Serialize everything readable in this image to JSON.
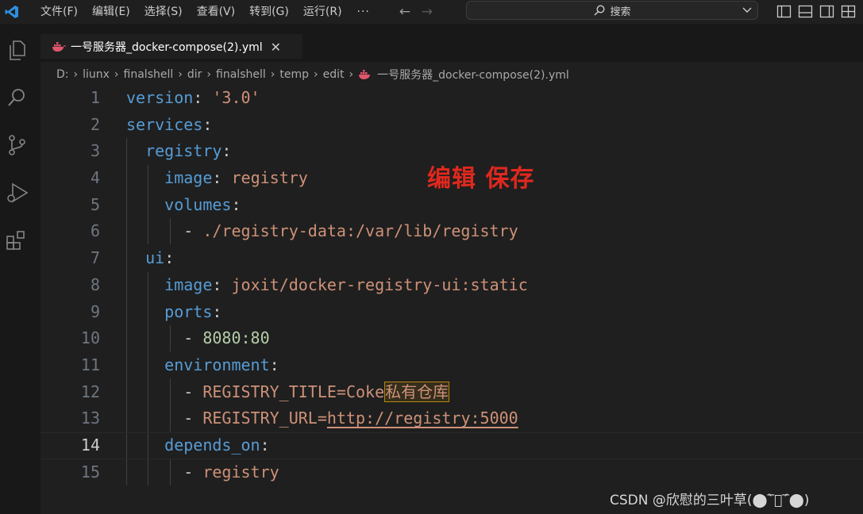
{
  "menu": {
    "items": [
      "文件(F)",
      "编辑(E)",
      "选择(S)",
      "查看(V)",
      "转到(G)",
      "运行(R)"
    ],
    "more": "···"
  },
  "search": {
    "label": "搜索"
  },
  "tab": {
    "title": "一号服务器_docker-compose(2).yml",
    "close": "✕"
  },
  "breadcrumb": [
    "D:",
    "liunx",
    "finalshell",
    "dir",
    "finalshell",
    "temp",
    "edit",
    "一号服务器_docker-compose(2).yml"
  ],
  "editor": {
    "current_line": 14,
    "lines": [
      {
        "no": "1",
        "tokens": [
          {
            "c": "k",
            "t": "version"
          },
          {
            "c": "p",
            "t": ": "
          },
          {
            "c": "s",
            "t": "'3.0'"
          }
        ]
      },
      {
        "no": "2",
        "tokens": [
          {
            "c": "k",
            "t": "services"
          },
          {
            "c": "p",
            "t": ":"
          }
        ]
      },
      {
        "no": "3",
        "tokens": [
          {
            "c": "p",
            "t": "  "
          },
          {
            "c": "k",
            "t": "registry"
          },
          {
            "c": "p",
            "t": ":"
          }
        ]
      },
      {
        "no": "4",
        "tokens": [
          {
            "c": "p",
            "t": "    "
          },
          {
            "c": "k",
            "t": "image"
          },
          {
            "c": "p",
            "t": ": "
          },
          {
            "c": "s",
            "t": "registry"
          }
        ]
      },
      {
        "no": "5",
        "tokens": [
          {
            "c": "p",
            "t": "    "
          },
          {
            "c": "k",
            "t": "volumes"
          },
          {
            "c": "p",
            "t": ":"
          }
        ]
      },
      {
        "no": "6",
        "tokens": [
          {
            "c": "p",
            "t": "      - "
          },
          {
            "c": "s",
            "t": "./registry-data:/var/lib/registry"
          }
        ]
      },
      {
        "no": "7",
        "tokens": [
          {
            "c": "p",
            "t": "  "
          },
          {
            "c": "k",
            "t": "ui"
          },
          {
            "c": "p",
            "t": ":"
          }
        ]
      },
      {
        "no": "8",
        "tokens": [
          {
            "c": "p",
            "t": "    "
          },
          {
            "c": "k",
            "t": "image"
          },
          {
            "c": "p",
            "t": ": "
          },
          {
            "c": "s",
            "t": "joxit/docker-registry-ui:static"
          }
        ]
      },
      {
        "no": "9",
        "tokens": [
          {
            "c": "p",
            "t": "    "
          },
          {
            "c": "k",
            "t": "ports"
          },
          {
            "c": "p",
            "t": ":"
          }
        ]
      },
      {
        "no": "10",
        "tokens": [
          {
            "c": "p",
            "t": "      - "
          },
          {
            "c": "n",
            "t": "8080:80"
          }
        ]
      },
      {
        "no": "11",
        "tokens": [
          {
            "c": "p",
            "t": "    "
          },
          {
            "c": "k",
            "t": "environment"
          },
          {
            "c": "p",
            "t": ":"
          }
        ]
      },
      {
        "no": "12",
        "tokens": [
          {
            "c": "p",
            "t": "      - "
          },
          {
            "c": "s",
            "t": "REGISTRY_TITLE=Coke"
          },
          {
            "c": "s cjk-hl",
            "t": "私有仓库"
          }
        ]
      },
      {
        "no": "13",
        "tokens": [
          {
            "c": "p",
            "t": "      - "
          },
          {
            "c": "s",
            "t": "REGISTRY_URL="
          },
          {
            "c": "s u",
            "t": "http://registry:5000"
          }
        ]
      },
      {
        "no": "14",
        "tokens": [
          {
            "c": "p",
            "t": "    "
          },
          {
            "c": "k",
            "t": "depends_on"
          },
          {
            "c": "p",
            "t": ":"
          }
        ]
      },
      {
        "no": "15",
        "tokens": [
          {
            "c": "p",
            "t": "      - "
          },
          {
            "c": "s",
            "t": "registry"
          }
        ]
      }
    ]
  },
  "annotation": "编辑  保存",
  "watermark": "CSDN @欣慰的三叶草(⬤‾̀⃝‾́⬤)",
  "colors": {
    "keyword": "#569cd6",
    "string": "#ce9178",
    "number": "#b5cea8",
    "annotation": "#e0281e"
  },
  "icons": {
    "activity": [
      "explorer-icon",
      "search-icon",
      "source-control-icon",
      "run-debug-icon",
      "extensions-icon"
    ],
    "layout": [
      "toggle-primary-sidebar-icon",
      "toggle-panel-icon",
      "toggle-secondary-sidebar-icon",
      "customize-layout-icon"
    ]
  }
}
